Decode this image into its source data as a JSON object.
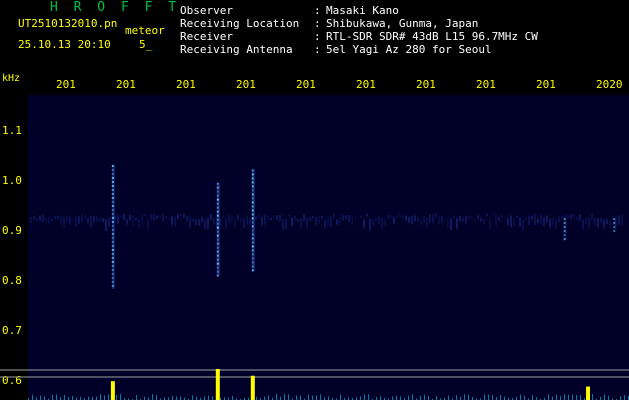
{
  "header": {
    "app_title": "H R O F F T",
    "filename": "UT2510132010.pn",
    "meteor_tag": "meteor",
    "datetime": "25.10.13 20:10",
    "count": "5_"
  },
  "metadata": [
    {
      "label": "Observer",
      "value": "Masaki Kano"
    },
    {
      "label": "Receiving Location",
      "value": "Shibukawa, Gunma, Japan"
    },
    {
      "label": "Receiver",
      "value": "RTL-SDR SDR# 43dB L15 96.7MHz CW"
    },
    {
      "label": "Receiving Antenna",
      "value": "5el Yagi Az 280 for Seoul"
    }
  ],
  "colors": {
    "title": "#00c040",
    "text": "#ffff00",
    "meta_text": "#ffffff",
    "axis_text": "#ffff00",
    "background": "#000000",
    "spectrogram_bg": "#000028",
    "echo": "#7fd0ff",
    "power": "#ffff00",
    "baseline": "#00a0c0",
    "hline": "#a0a0a0"
  },
  "axis_unit": "kHz",
  "time_ticks": [
    "201",
    "201",
    "201",
    "201",
    "201",
    "201",
    "201",
    "201",
    "201",
    "2020"
  ],
  "freq_ticks": [
    "1.1",
    "1.0",
    "0.9",
    "0.8",
    "0.7",
    "0.6"
  ],
  "chart_data": {
    "type": "heatmap",
    "xlabel": "",
    "ylabel": "kHz",
    "ylim": [
      0.57,
      1.18
    ],
    "xlim": [
      0,
      10
    ],
    "carrier_band": [
      0.88,
      0.93
    ],
    "echoes": [
      {
        "x": 1.25,
        "f_lo": 0.76,
        "f_hi": 1.04,
        "intensity": 0.9
      },
      {
        "x": 3.05,
        "f_lo": 0.79,
        "f_hi": 1.0,
        "intensity": 1.0
      },
      {
        "x": 3.65,
        "f_lo": 0.8,
        "f_hi": 1.03,
        "intensity": 1.0
      },
      {
        "x": 9.0,
        "f_lo": 0.87,
        "f_hi": 0.92,
        "intensity": 0.5
      },
      {
        "x": 9.85,
        "f_lo": 0.89,
        "f_hi": 0.92,
        "intensity": 0.4
      }
    ],
    "power_peaks": [
      {
        "x": 1.25,
        "level": 0.55
      },
      {
        "x": 3.05,
        "level": 1.0
      },
      {
        "x": 3.65,
        "level": 0.75
      },
      {
        "x": 9.4,
        "level": 0.35
      }
    ]
  }
}
